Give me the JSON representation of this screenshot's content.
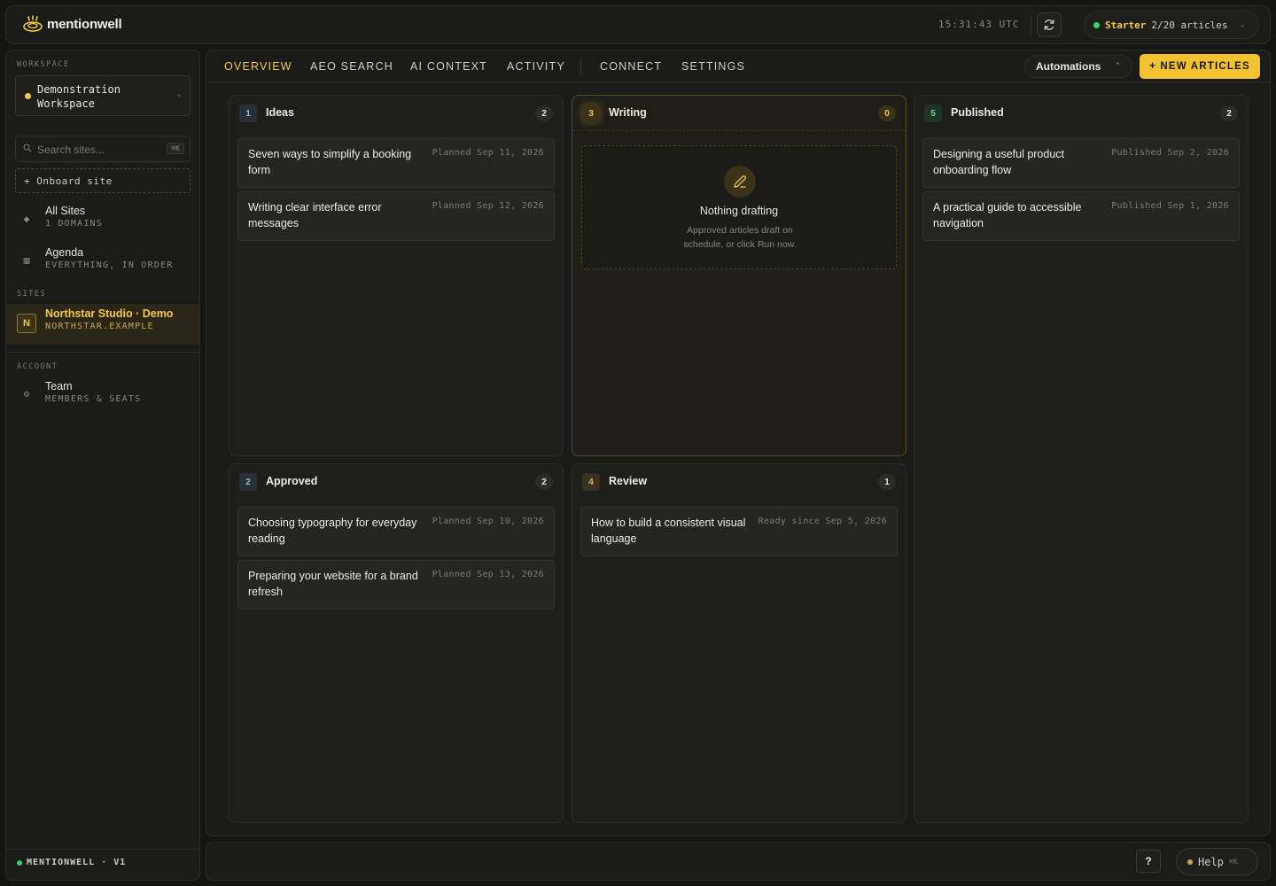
{
  "app": {
    "brand": "mentionwell",
    "clock": "15:31:43 UTC",
    "plan": {
      "name": "Starter",
      "usage": "2/20 articles"
    }
  },
  "sidebar": {
    "workspace_label": "WORKSPACE",
    "workspace_name": "Demonstration Workspace",
    "search_placeholder": "Search sites...",
    "search_kbd": "⌘K",
    "onboard_label": "+ Onboard site",
    "nav": [
      {
        "title": "All Sites",
        "sub": "1 DOMAINS"
      },
      {
        "title": "Agenda",
        "sub": "EVERYTHING, IN ORDER"
      }
    ],
    "sites_label": "SITES",
    "site": {
      "badge": "N",
      "title": "Northstar Studio · Demo",
      "sub": "NORTHSTAR.EXAMPLE"
    },
    "account_label": "ACCOUNT",
    "account_item": {
      "title": "Team",
      "sub": "MEMBERS & SEATS"
    },
    "footer": "MENTIONWELL · V1"
  },
  "tabs": [
    "OVERVIEW",
    "AEO SEARCH",
    "AI CONTEXT",
    "ACTIVITY",
    "CONNECT",
    "SETTINGS"
  ],
  "actions": {
    "automations": "Automations",
    "new_articles": "+ NEW ARTICLES"
  },
  "columns": {
    "ideas": {
      "num": "1",
      "title": "Ideas",
      "count": "2",
      "cards": [
        {
          "title": "Seven ways to simplify a booking form",
          "meta": "Planned Sep 11, 2026"
        },
        {
          "title": "Writing clear interface error messages",
          "meta": "Planned Sep 12, 2026"
        }
      ]
    },
    "approved": {
      "num": "2",
      "title": "Approved",
      "count": "2",
      "cards": [
        {
          "title": "Choosing typography for everyday reading",
          "meta": "Planned Sep 10, 2026"
        },
        {
          "title": "Preparing your website for a brand refresh",
          "meta": "Planned Sep 13, 2026"
        }
      ]
    },
    "writing": {
      "num": "3",
      "title": "Writing",
      "count": "0",
      "empty_title": "Nothing drafting",
      "empty_desc": "Approved articles draft on schedule, or click Run now."
    },
    "review": {
      "num": "4",
      "title": "Review",
      "count": "1",
      "cards": [
        {
          "title": "How to build a consistent visual language",
          "meta": "Ready since Sep 5, 2026"
        }
      ]
    },
    "published": {
      "num": "5",
      "title": "Published",
      "count": "2",
      "cards": [
        {
          "title": "Designing a useful product onboarding flow",
          "meta": "Published Sep 2, 2026"
        },
        {
          "title": "A practical guide to accessible navigation",
          "meta": "Published Sep 1, 2026"
        }
      ]
    }
  },
  "bottombar": {
    "question": "?",
    "help": "Help",
    "help_kbd": "⌘K"
  },
  "colors": {
    "accent": "#f2c230",
    "status_green": "#3ecf6e",
    "bg": "#141412"
  }
}
